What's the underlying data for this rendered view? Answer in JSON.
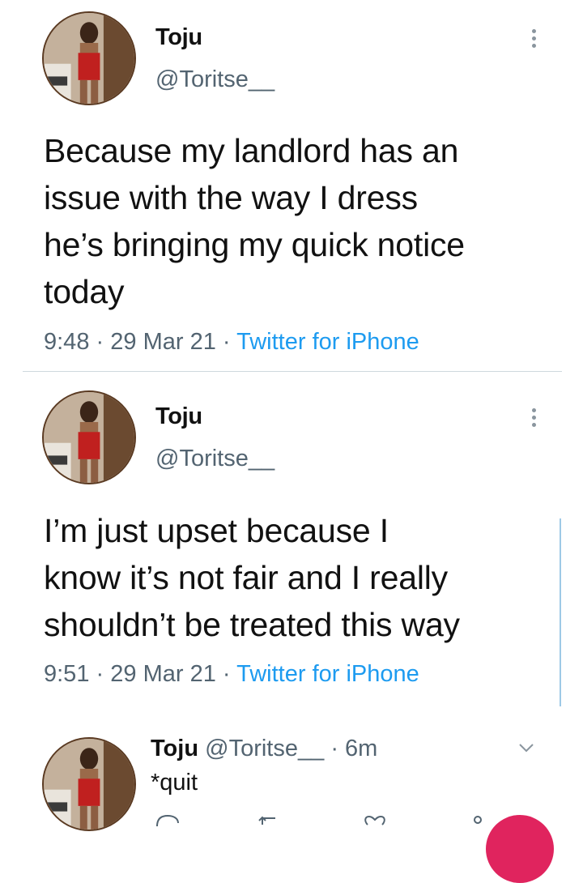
{
  "tweets": [
    {
      "display_name": "Toju",
      "handle": "@Toritse__",
      "text": "Because my landlord has an issue with the way I dress he’s bringing my quick notice today",
      "lines": [
        "Because my landlord has an",
        "issue with the way I dress",
        "he’s bringing my quick notice",
        "today"
      ],
      "time": "9:48",
      "date": "29 Mar 21",
      "source": "Twitter for iPhone",
      "sep": "·"
    },
    {
      "display_name": "Toju",
      "handle": "@Toritse__",
      "lines": [
        "I’m just upset because I",
        "know it’s not fair and I really",
        "shouldn’t be treated this way"
      ],
      "time": "9:51",
      "date": "29 Mar 21",
      "source": "Twitter for iPhone",
      "sep": "·"
    }
  ],
  "reply": {
    "display_name": "Toju",
    "handle": "@Toritse__",
    "age": "· 6m",
    "text": "*quit"
  },
  "icons": {
    "more": "more-vertical-icon",
    "chevron": "chevron-down-icon",
    "reply": "reply-icon",
    "retweet": "retweet-icon",
    "like": "heart-icon",
    "share": "share-icon"
  },
  "colors": {
    "link": "#1d9bf0",
    "muted": "#536471",
    "divider": "#cfd9de",
    "thread_line": "#9ec9e6",
    "accent_red": "#e0245e"
  }
}
